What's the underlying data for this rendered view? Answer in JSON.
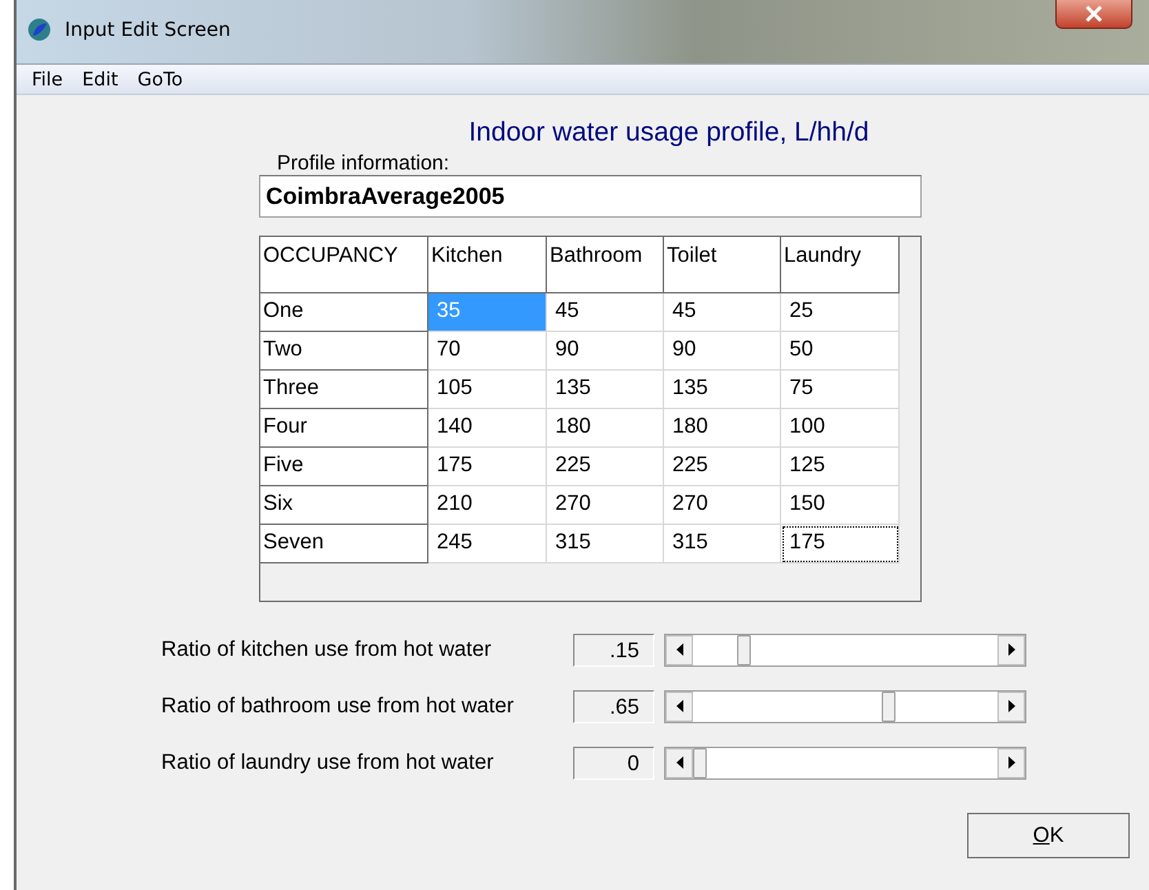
{
  "window": {
    "title": "Input Edit Screen"
  },
  "menu": [
    "File",
    "Edit",
    "GoTo"
  ],
  "heading": "Indoor water usage profile, L/hh/d",
  "profile": {
    "label": "Profile information:",
    "value": "CoimbraAverage2005"
  },
  "table": {
    "columns": [
      "OCCUPANCY",
      "Kitchen",
      "Bathroom",
      "Toilet",
      "Laundry"
    ],
    "rows": [
      {
        "cells": [
          {
            "text": "One",
            "selected": false,
            "focused": false
          },
          {
            "text": "35",
            "selected": true,
            "focused": false
          },
          {
            "text": "45",
            "selected": false,
            "focused": false
          },
          {
            "text": "45",
            "selected": false,
            "focused": false
          },
          {
            "text": "25",
            "selected": false,
            "focused": false
          }
        ]
      },
      {
        "cells": [
          {
            "text": "Two",
            "selected": false,
            "focused": false
          },
          {
            "text": "70",
            "selected": false,
            "focused": false
          },
          {
            "text": "90",
            "selected": false,
            "focused": false
          },
          {
            "text": "90",
            "selected": false,
            "focused": false
          },
          {
            "text": "50",
            "selected": false,
            "focused": false
          }
        ]
      },
      {
        "cells": [
          {
            "text": "Three",
            "selected": false,
            "focused": false
          },
          {
            "text": "105",
            "selected": false,
            "focused": false
          },
          {
            "text": "135",
            "selected": false,
            "focused": false
          },
          {
            "text": "135",
            "selected": false,
            "focused": false
          },
          {
            "text": "75",
            "selected": false,
            "focused": false
          }
        ]
      },
      {
        "cells": [
          {
            "text": "Four",
            "selected": false,
            "focused": false
          },
          {
            "text": "140",
            "selected": false,
            "focused": false
          },
          {
            "text": "180",
            "selected": false,
            "focused": false
          },
          {
            "text": "180",
            "selected": false,
            "focused": false
          },
          {
            "text": "100",
            "selected": false,
            "focused": false
          }
        ]
      },
      {
        "cells": [
          {
            "text": "Five",
            "selected": false,
            "focused": false
          },
          {
            "text": "175",
            "selected": false,
            "focused": false
          },
          {
            "text": "225",
            "selected": false,
            "focused": false
          },
          {
            "text": "225",
            "selected": false,
            "focused": false
          },
          {
            "text": "125",
            "selected": false,
            "focused": false
          }
        ]
      },
      {
        "cells": [
          {
            "text": "Six",
            "selected": false,
            "focused": false
          },
          {
            "text": "210",
            "selected": false,
            "focused": false
          },
          {
            "text": "270",
            "selected": false,
            "focused": false
          },
          {
            "text": "270",
            "selected": false,
            "focused": false
          },
          {
            "text": "150",
            "selected": false,
            "focused": false
          }
        ]
      },
      {
        "cells": [
          {
            "text": "Seven",
            "selected": false,
            "focused": false
          },
          {
            "text": "245",
            "selected": false,
            "focused": false
          },
          {
            "text": "315",
            "selected": false,
            "focused": false
          },
          {
            "text": "315",
            "selected": false,
            "focused": false
          },
          {
            "text": "175",
            "selected": false,
            "focused": true
          }
        ]
      }
    ]
  },
  "ratios": [
    {
      "label": "Ratio of kitchen use from hot water",
      "value": ".15"
    },
    {
      "label": "Ratio of bathroom use from hot water",
      "value": ".65"
    },
    {
      "label": "Ratio of laundry use from hot water",
      "value": "0"
    }
  ],
  "buttons": [
    "OK"
  ]
}
